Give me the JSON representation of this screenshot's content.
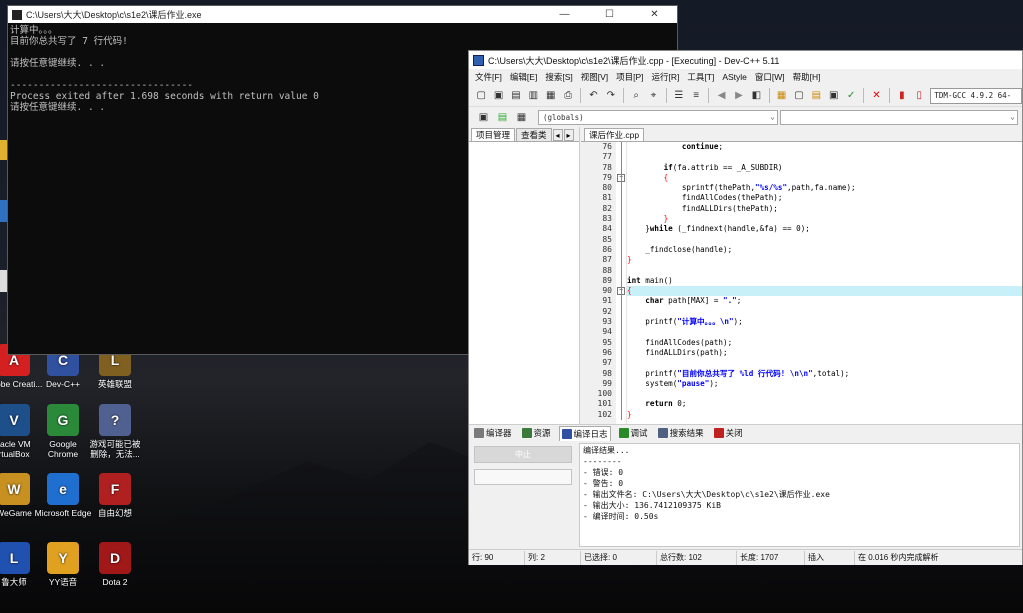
{
  "console": {
    "title": "C:\\Users\\大大\\Desktop\\c\\s1e2\\课后作业.exe",
    "lines": [
      "计算中。。。",
      "目前你总共写了 7 行代码!",
      "",
      "请按任意键继续. . .",
      "",
      "--------------------------------",
      "Process exited after 1.698 seconds with return value 0",
      "请按任意键继续. . ."
    ],
    "controls": {
      "minimize": "—",
      "maximize": "☐",
      "close": "✕"
    }
  },
  "desktop_icons": [
    {
      "label": "Adobe Creati...",
      "color": "#d42020",
      "glyph": "A"
    },
    {
      "label": "Dev-C++",
      "color": "#3050a0",
      "glyph": "C"
    },
    {
      "label": "英雄联盟",
      "color": "#806020",
      "glyph": "L"
    },
    {
      "label": "racle VM rtualBox",
      "color": "#1d4f8a",
      "glyph": "V"
    },
    {
      "label": "Google Chrome",
      "color": "#2a8a3a",
      "glyph": "G"
    },
    {
      "label": "游戏可能已被删除，无法...",
      "color": "#506090",
      "glyph": "?"
    },
    {
      "label": "WeGame",
      "color": "#c89020",
      "glyph": "W"
    },
    {
      "label": "Microsoft Edge",
      "color": "#1f6fd0",
      "glyph": "e"
    },
    {
      "label": "自由幻想",
      "color": "#b02020",
      "glyph": "F"
    },
    {
      "label": "鲁大师",
      "color": "#2050b0",
      "glyph": "L"
    },
    {
      "label": "YY语音",
      "color": "#e0a020",
      "glyph": "Y"
    },
    {
      "label": "Dota 2",
      "color": "#a01818",
      "glyph": "D"
    }
  ],
  "devcpp": {
    "title": "C:\\Users\\大大\\Desktop\\c\\s1e2\\课后作业.cpp - [Executing] - Dev-C++ 5.11",
    "menu": [
      "文件[F]",
      "编辑[E]",
      "搜索[S]",
      "视图[V]",
      "项目[P]",
      "运行[R]",
      "工具[T]",
      "AStyle",
      "窗口[W]",
      "帮助[H]"
    ],
    "compiler": "TDM-GCC 4.9.2 64-",
    "globals_combo": "(globals)",
    "left_tabs": [
      "项目管理",
      "查看类"
    ],
    "editor_tab": "课后作业.cpp",
    "code_lines": [
      {
        "n": "76",
        "text": "            continue;"
      },
      {
        "n": "77",
        "text": ""
      },
      {
        "n": "78",
        "text": "        if(fa.attrib == _A_SUBDIR)"
      },
      {
        "n": "79",
        "text": "        {"
      },
      {
        "n": "80",
        "text": "            sprintf(thePath,\"%s/%s\",path,fa.name);"
      },
      {
        "n": "81",
        "text": "            findAllCodes(thePath);"
      },
      {
        "n": "82",
        "text": "            findALLDirs(thePath);"
      },
      {
        "n": "83",
        "text": "        }"
      },
      {
        "n": "84",
        "text": "    }while (_findnext(handle,&fa) == 0);"
      },
      {
        "n": "85",
        "text": ""
      },
      {
        "n": "86",
        "text": "    _findclose(handle);"
      },
      {
        "n": "87",
        "text": "}"
      },
      {
        "n": "88",
        "text": ""
      },
      {
        "n": "89",
        "text": "int main()"
      },
      {
        "n": "90",
        "text": "{"
      },
      {
        "n": "91",
        "text": "    char path[MAX] = \".\";"
      },
      {
        "n": "92",
        "text": ""
      },
      {
        "n": "93",
        "text": "    printf(\"计算中。。。\\n\");"
      },
      {
        "n": "94",
        "text": ""
      },
      {
        "n": "95",
        "text": "    findAllCodes(path);"
      },
      {
        "n": "96",
        "text": "    findALLDirs(path);"
      },
      {
        "n": "97",
        "text": ""
      },
      {
        "n": "98",
        "text": "    printf(\"目前你总共写了 %ld 行代码! \\n\\n\",total);"
      },
      {
        "n": "99",
        "text": "    system(\"pause\");"
      },
      {
        "n": "100",
        "text": ""
      },
      {
        "n": "101",
        "text": "    return 0;"
      },
      {
        "n": "102",
        "text": "}"
      }
    ],
    "bottom_tabs": [
      "编译器",
      "资源",
      "编译日志",
      "调试",
      "搜索结果",
      "关闭"
    ],
    "abort_label": "中止",
    "log_lines": [
      "编译结果...",
      "--------",
      "- 错误: 0",
      "- 警告: 0",
      "- 输出文件名: C:\\Users\\大大\\Desktop\\c\\s1e2\\课后作业.exe",
      "- 输出大小: 136.7412109375 KiB",
      "- 编译时间: 0.50s"
    ],
    "status": {
      "row_label": "行:",
      "row": "90",
      "col_label": "列:",
      "col": "2",
      "sel_label": "已选择:",
      "sel": "0",
      "total_label": "总行数:",
      "total": "102",
      "len_label": "长度:",
      "len": "1707",
      "mode": "插入",
      "parse": "在 0.016 秒内完成解析"
    }
  }
}
